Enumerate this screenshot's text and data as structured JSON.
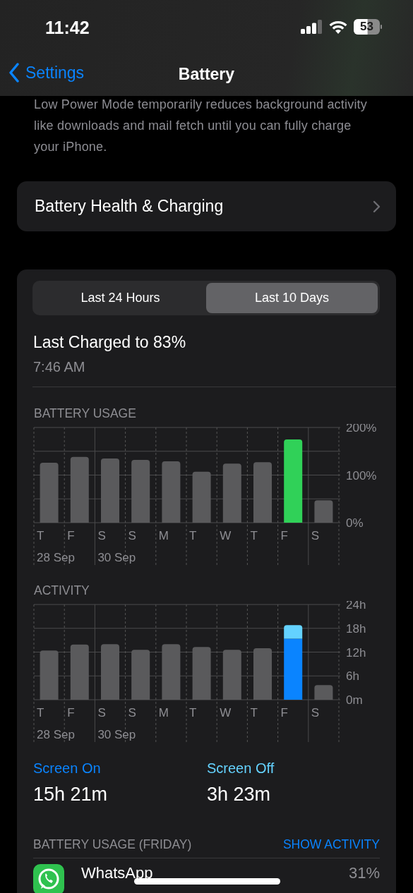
{
  "status_bar": {
    "time": "11:42",
    "battery": "53"
  },
  "nav": {
    "back": "Settings",
    "title": "Battery"
  },
  "low_power_note": "Low Power Mode temporarily reduces background activity like downloads and mail fetch until you can fully charge your iPhone.",
  "health_row": {
    "label": "Battery Health & Charging"
  },
  "tabs": [
    {
      "label": "Last 24 Hours",
      "selected": false
    },
    {
      "label": "Last 10 Days",
      "selected": true
    }
  ],
  "last_charged": {
    "title": "Last Charged to 83%",
    "time": "7:46 AM"
  },
  "battery_usage": {
    "title": "BATTERY USAGE",
    "date_labels": [
      "28 Sep",
      "30 Sep"
    ],
    "chart_data": {
      "type": "bar",
      "categories": [
        "T",
        "F",
        "S",
        "S",
        "M",
        "T",
        "W",
        "T",
        "F",
        "S"
      ],
      "stacked": true,
      "grid": true,
      "ylim": [
        0,
        200
      ],
      "yticks": [
        {
          "value": 0,
          "label": "0%"
        },
        {
          "value": 100,
          "label": "100%"
        },
        {
          "value": 200,
          "label": "200%"
        }
      ],
      "series": [
        {
          "color": "#5a5a5c",
          "values": [
            126,
            138,
            135,
            132,
            129,
            107,
            124,
            127,
            null,
            47
          ]
        },
        {
          "color": "#30d158",
          "values": [
            null,
            null,
            null,
            null,
            null,
            null,
            null,
            null,
            175,
            null
          ]
        }
      ]
    }
  },
  "activity": {
    "title": "ACTIVITY",
    "date_labels": [
      "28 Sep",
      "30 Sep"
    ],
    "chart_data": {
      "type": "bar",
      "categories": [
        "T",
        "F",
        "S",
        "S",
        "M",
        "T",
        "W",
        "T",
        "F",
        "S"
      ],
      "stacked": true,
      "grid": true,
      "ylim": [
        0,
        24
      ],
      "yticks": [
        {
          "value": 0,
          "label": "0m"
        },
        {
          "value": 6,
          "label": "6h"
        },
        {
          "value": 12,
          "label": "12h"
        },
        {
          "value": 18,
          "label": "18h"
        },
        {
          "value": 24,
          "label": "24h"
        }
      ],
      "series": [
        {
          "color": "#5a5a5c",
          "values": [
            12.4,
            13.9,
            14,
            12.6,
            14,
            13.3,
            12.6,
            13,
            null,
            3.7
          ]
        },
        {
          "color": "#0a84ff",
          "values": [
            null,
            null,
            null,
            null,
            null,
            null,
            null,
            null,
            15.4,
            null
          ]
        },
        {
          "color": "#64d2ff",
          "values": [
            null,
            null,
            null,
            null,
            null,
            null,
            null,
            null,
            3.4,
            null
          ]
        }
      ]
    }
  },
  "screen_time": [
    {
      "label": "Screen On",
      "value": "15h 21m",
      "color": "#0a84ff"
    },
    {
      "label": "Screen Off",
      "value": "3h 23m",
      "color": "#64d2ff"
    }
  ],
  "app_usage": {
    "title": "BATTERY USAGE (FRIDAY)",
    "action": "SHOW ACTIVITY",
    "apps": [
      {
        "name": "WhatsApp",
        "percent": "31%"
      }
    ]
  }
}
